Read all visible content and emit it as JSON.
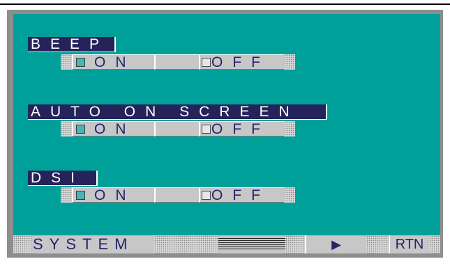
{
  "settings": [
    {
      "label": "BEEP",
      "on_label": "ON",
      "off_label": "OFF",
      "selected": "on"
    },
    {
      "label": "AUTO ON SCREEN",
      "on_label": "ON",
      "off_label": "OFF",
      "selected": "on"
    },
    {
      "label": "DSI",
      "on_label": "ON",
      "off_label": "OFF",
      "selected": "on"
    }
  ],
  "bottom_bar": {
    "title": "SYSTEM",
    "play_glyph": "▶",
    "return_label": "RTN"
  },
  "colors": {
    "screen_bg": "#00a09a",
    "label_bg": "#25235a",
    "bar_bg": "#c7c7c7",
    "text": "#24246b",
    "checked": "#46b7b7",
    "frame": "#8e8e8e"
  }
}
